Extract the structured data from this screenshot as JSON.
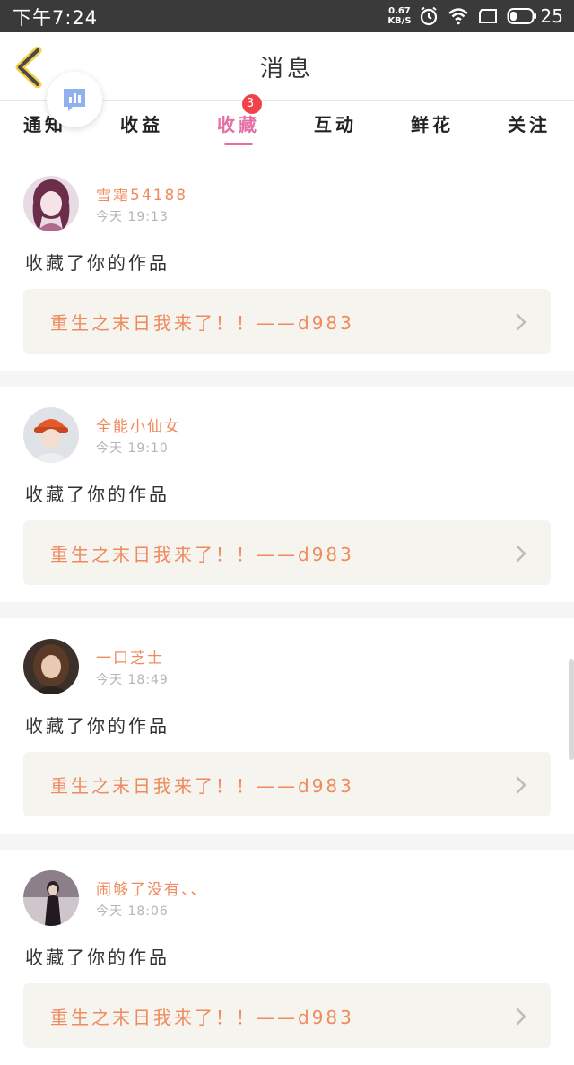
{
  "status_bar": {
    "time": "下午7:24",
    "net_speed_value": "0.67",
    "net_speed_unit": "KB/S",
    "battery": "25"
  },
  "header": {
    "title": "消息"
  },
  "tabs": [
    {
      "label": "通知"
    },
    {
      "label": "收益"
    },
    {
      "label": "收藏",
      "badge": "3",
      "active": true
    },
    {
      "label": "互动"
    },
    {
      "label": "鲜花"
    },
    {
      "label": "关注"
    }
  ],
  "colors": {
    "accent": "#e56fa4",
    "username": "#f08a5d",
    "badge": "#f0424a",
    "work_bg": "#f5f4ef"
  },
  "feed": [
    {
      "username": "雪霜54188",
      "time": "今天  19:13",
      "action": "收藏了你的作品",
      "work_title": "重生之末日我来了！！——d983"
    },
    {
      "username": "全能小仙女",
      "time": "今天  19:10",
      "action": "收藏了你的作品",
      "work_title": "重生之末日我来了！！——d983"
    },
    {
      "username": "一口芝士",
      "time": "今天  18:49",
      "action": "收藏了你的作品",
      "work_title": "重生之末日我来了！！——d983"
    },
    {
      "username": "闹够了没有、、",
      "time": "今天  18:06",
      "action": "收藏了你的作品",
      "work_title": "重生之末日我来了！！——d983"
    }
  ]
}
